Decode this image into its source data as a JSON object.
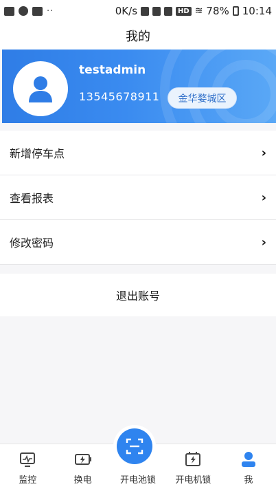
{
  "status_bar": {
    "speed": "0K/s",
    "hd": "HD",
    "battery": "78%",
    "time": "10:14",
    "dots": "··"
  },
  "header": {
    "title": "我的"
  },
  "profile": {
    "username": "testadmin",
    "phone": "13545678911",
    "region": "金华婺城区",
    "avatar_icon": "user-avatar-icon"
  },
  "menu": {
    "items": [
      {
        "label": "新增停车点",
        "icon": "chevron-right-icon"
      },
      {
        "label": "查看报表",
        "icon": "chevron-right-icon"
      },
      {
        "label": "修改密码",
        "icon": "chevron-right-icon"
      }
    ]
  },
  "logout": {
    "label": "退出账号"
  },
  "bottom_nav": {
    "items": [
      {
        "label": "监控",
        "icon": "monitor-icon"
      },
      {
        "label": "换电",
        "icon": "battery-swap-icon"
      },
      {
        "label": "开电池锁",
        "icon": "scan-icon"
      },
      {
        "label": "开电机锁",
        "icon": "motor-lock-icon"
      },
      {
        "label": "我",
        "icon": "person-icon"
      }
    ],
    "active_index": 4
  },
  "colors": {
    "primary": "#2f84ef",
    "profile_gradient_start": "#2f7de6",
    "profile_gradient_end": "#5aa8f6",
    "region_button_bg": "#eaf3fd",
    "active_nav": "#2f84ef"
  }
}
